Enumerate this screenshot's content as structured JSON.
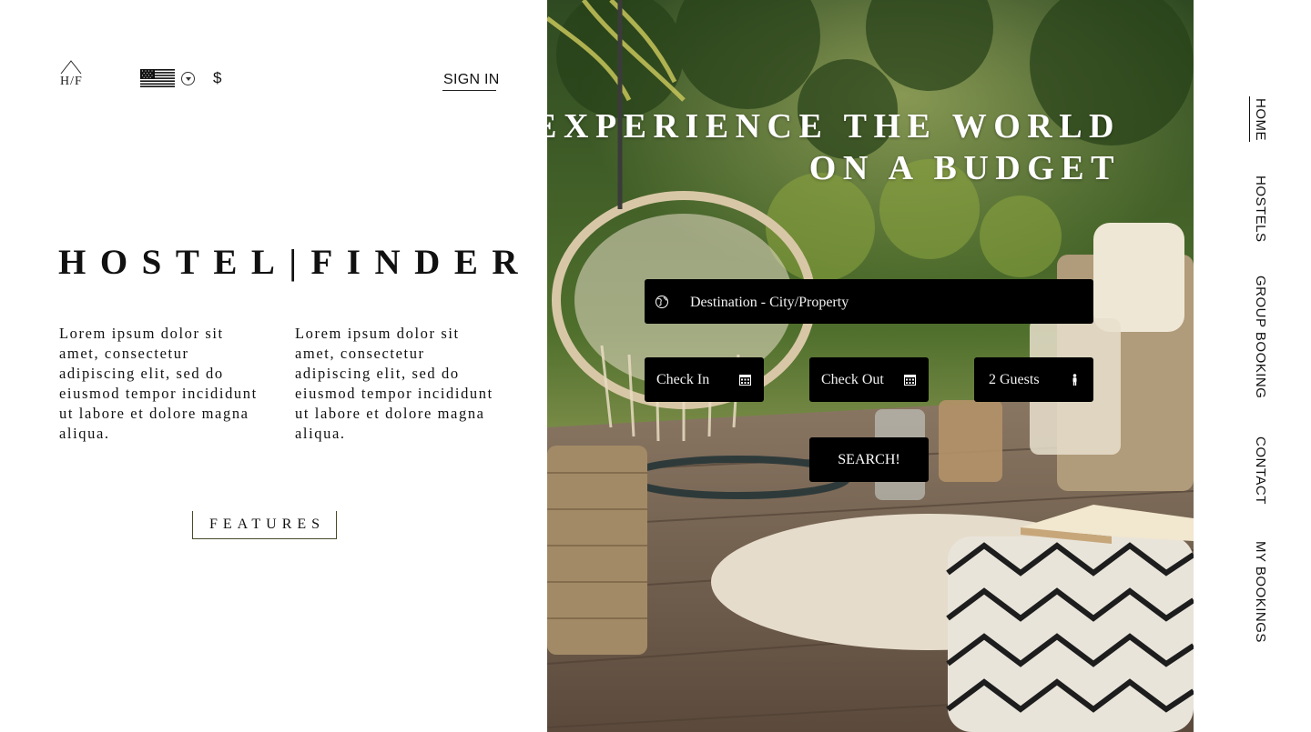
{
  "header": {
    "logo_text": "H/F",
    "locale_flag": "us-flag",
    "locale_chevron_icon": "chevron-down-circle-icon",
    "currency_symbol": "$",
    "sign_in_label": "SIGN IN"
  },
  "intro": {
    "brand": "HOSTEL|FINDER",
    "paragraph_one": "Lorem ipsum dolor sit amet, consectetur adipiscing elit, sed do eiusmod tempor incididunt ut labore et dolore magna aliqua.",
    "paragraph_two": "Lorem ipsum dolor sit amet, consectetur adipiscing elit, sed do eiusmod tempor incididunt ut labore et dolore magna aliqua.",
    "features_label": "FEATURES"
  },
  "hero": {
    "title_line1": "EXPERIENCE THE WORLD",
    "title_line2": "ON A BUDGET",
    "search": {
      "destination_placeholder": "Destination - City/Property",
      "destination_icon": "globe-icon",
      "check_in_label": "Check In",
      "check_out_label": "Check Out",
      "calendar_icon": "calendar-icon",
      "guests_label": "2 Guests",
      "guests_icon": "person-icon",
      "search_label": "SEARCH!"
    }
  },
  "nav": {
    "items": [
      {
        "label": "HOME",
        "active": true
      },
      {
        "label": "HOSTELS",
        "active": false
      },
      {
        "label": "GROUP BOOKING",
        "active": false
      },
      {
        "label": "CONTACT",
        "active": false
      },
      {
        "label": "MY BOOKINGS",
        "active": false
      }
    ]
  },
  "colors": {
    "background": "#ffffff",
    "text": "#111111",
    "search_fields": "#000000",
    "hero_title": "#ffffff",
    "features_border": "#4a4a2a"
  }
}
